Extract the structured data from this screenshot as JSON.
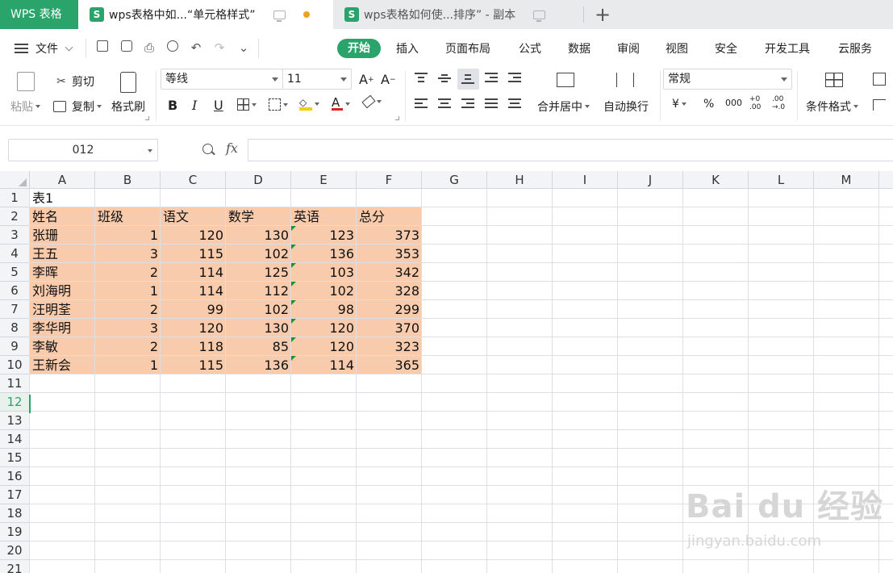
{
  "tabs": {
    "app": "WPS 表格",
    "doc1": "wps表格中如...“单元格样式”",
    "doc2": "wps表格如何使...排序”  - 副本",
    "new_tab": "+"
  },
  "menu": {
    "file": "文件",
    "items": [
      "开始",
      "插入",
      "页面布局",
      "公式",
      "数据",
      "审阅",
      "视图",
      "安全",
      "开发工具",
      "云服务"
    ]
  },
  "ribbon": {
    "paste": "粘贴",
    "cut": "剪切",
    "copy": "复制",
    "format_painter": "格式刷",
    "font_name": "等线",
    "font_size": "11",
    "bold": "B",
    "italic": "I",
    "underline": "U",
    "merge_center": "合并居中",
    "wrap_text": "自动换行",
    "number_format": "常规",
    "currency": "¥",
    "percent": "%",
    "thousands": "000",
    "inc_decimal": "+0\n.00",
    "dec_decimal": ".00\n→.0",
    "conditional_format": "条件格式"
  },
  "formula_bar": {
    "name_box": "012",
    "fx": "fx",
    "content": ""
  },
  "columns": [
    "A",
    "B",
    "C",
    "D",
    "E",
    "F",
    "G",
    "H",
    "I",
    "J",
    "K",
    "L",
    "M"
  ],
  "rows": [
    "1",
    "2",
    "3",
    "4",
    "5",
    "6",
    "7",
    "8",
    "9",
    "10",
    "11",
    "12",
    "13",
    "14",
    "15",
    "16",
    "17",
    "18",
    "19",
    "20",
    "21"
  ],
  "sheet": {
    "title": "表1",
    "headers": [
      "姓名",
      "班级",
      "语文",
      "数学",
      "英语",
      "总分"
    ],
    "data": [
      [
        "张珊",
        "1",
        "120",
        "130",
        "123",
        "373"
      ],
      [
        "王五",
        "3",
        "115",
        "102",
        "136",
        "353"
      ],
      [
        "李晖",
        "2",
        "114",
        "125",
        "103",
        "342"
      ],
      [
        "刘海明",
        "1",
        "114",
        "112",
        "102",
        "328"
      ],
      [
        "汪明荃",
        "2",
        "99",
        "102",
        "98",
        "299"
      ],
      [
        "李华明",
        "3",
        "120",
        "130",
        "120",
        "370"
      ],
      [
        "李敏",
        "2",
        "118",
        "85",
        "120",
        "323"
      ],
      [
        "王新会",
        "1",
        "115",
        "136",
        "114",
        "365"
      ]
    ]
  },
  "colors": {
    "accent": "#2aa46b",
    "data_fill": "#f8cbad"
  },
  "watermark": {
    "brand": "Bai du 经验",
    "url": "jingyan.baidu.com"
  }
}
